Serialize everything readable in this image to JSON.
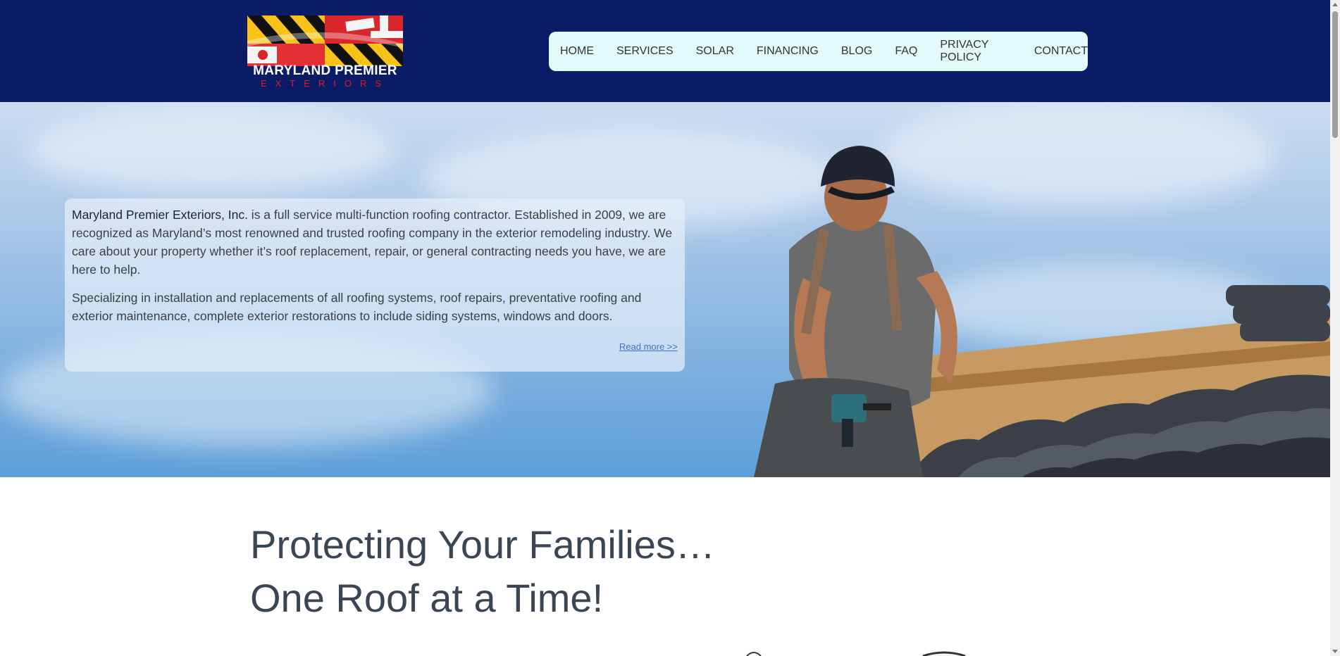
{
  "header": {
    "logo_name": "MARYLAND PREMIER",
    "logo_sub": "EXTERIORS",
    "nav": [
      {
        "label": "HOME"
      },
      {
        "label": "SERVICES"
      },
      {
        "label": "SOLAR"
      },
      {
        "label": "FINANCING"
      },
      {
        "label": "BLOG"
      },
      {
        "label": "FAQ"
      },
      {
        "label": "PRIVACY POLICY"
      },
      {
        "label": "CONTACT"
      }
    ]
  },
  "hero": {
    "company_name": "Maryland Premier Exteriors, Inc.",
    "intro_rest": " is a full service multi-function roofing contractor. Established in 2009, we are recognized as Maryland’s most renowned and trusted roofing company in the exterior remodeling industry. We care about your property whether it’s roof replacement, repair, or general contracting needs you have, we are here to help.",
    "paragraph2": "Specializing in installation and replacements of all roofing systems, roof repairs, preventative roofing and exterior maintenance, complete exterior restorations to include siding systems, windows and doors.",
    "read_more": "Read more >>"
  },
  "tagline": {
    "line1": "Protecting Your Families…",
    "line2": "One Roof at a Time!"
  },
  "colors": {
    "header_bg": "#0a1c66",
    "nav_bg": "#e2fbfa",
    "logo_red": "#e0182b",
    "link_blue": "#3a73c7"
  },
  "icons": {
    "logo": "maryland-flag-logo",
    "hero_image": "roofer-installing-tiles"
  }
}
